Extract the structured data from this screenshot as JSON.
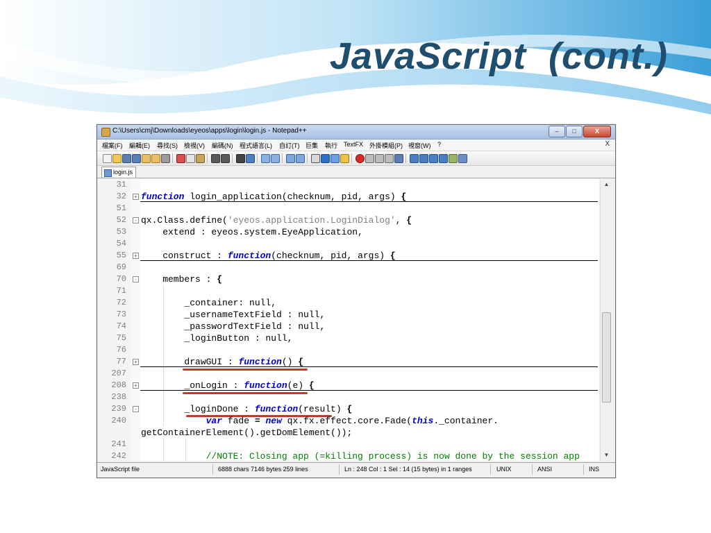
{
  "slide": {
    "title": "JavaScript  (cont.)"
  },
  "window": {
    "title": "C:\\Users\\cmj\\Downloads\\eyeos\\apps\\login\\login.js - Notepad++",
    "controls": {
      "minimize": "–",
      "maximize": "□",
      "close": "X"
    }
  },
  "menu": {
    "items": [
      "檔案(F)",
      "編輯(E)",
      "尋找(S)",
      "檢視(V)",
      "編碼(N)",
      "程式語言(L)",
      "自訂(T)",
      "巨集",
      "執行",
      "TextFX",
      "外掛模組(P)",
      "視窗(W)",
      "?"
    ],
    "close": "X"
  },
  "toolbar": {
    "icons": [
      "new-icon",
      "open-icon",
      "save-icon",
      "save-all-icon",
      "close-icon",
      "close-all-icon",
      "print-icon",
      "cut-icon",
      "copy-icon",
      "paste-icon",
      "undo-icon",
      "redo-icon",
      "find-icon",
      "replace-icon",
      "zoom-in-icon",
      "zoom-out-icon",
      "sync-v-icon",
      "sync-h-icon",
      "wrap-icon",
      "all-chars-icon",
      "indent-guide-icon",
      "udl-icon",
      "record-icon",
      "stop-icon",
      "play-icon",
      "play-multi-icon",
      "save-macro-icon",
      "compare-icon",
      "up-icon",
      "down-icon",
      "next-icon",
      "highlight-icon",
      "spell-icon"
    ]
  },
  "tab": {
    "label": "login.js"
  },
  "editor": {
    "lines": [
      {
        "num": "31",
        "text": "",
        "fold": ""
      },
      {
        "num": "32",
        "text": "function login_application(checknum, pid, args) {",
        "fold": "+"
      },
      {
        "num": "51",
        "text": "",
        "fold": ""
      },
      {
        "num": "52",
        "text": "qx.Class.define('eyeos.application.LoginDialog', {",
        "fold": "-"
      },
      {
        "num": "53",
        "text": "    extend : eyeos.system.EyeApplication,",
        "fold": ""
      },
      {
        "num": "54",
        "text": "",
        "fold": ""
      },
      {
        "num": "55",
        "text": "    construct : function(checknum, pid, args) {",
        "fold": "+"
      },
      {
        "num": "69",
        "text": "",
        "fold": ""
      },
      {
        "num": "70",
        "text": "    members : {",
        "fold": "-"
      },
      {
        "num": "71",
        "text": "",
        "fold": ""
      },
      {
        "num": "72",
        "text": "        _container: null,",
        "fold": ""
      },
      {
        "num": "73",
        "text": "        _usernameTextField : null,",
        "fold": ""
      },
      {
        "num": "74",
        "text": "        _passwordTextField : null,",
        "fold": ""
      },
      {
        "num": "75",
        "text": "        _loginButton : null,",
        "fold": ""
      },
      {
        "num": "76",
        "text": "",
        "fold": ""
      },
      {
        "num": "77",
        "text": "        drawGUI : function() {",
        "fold": "+"
      },
      {
        "num": "207",
        "text": "",
        "fold": ""
      },
      {
        "num": "208",
        "text": "        _onLogin : function(e) {",
        "fold": "+"
      },
      {
        "num": "238",
        "text": "",
        "fold": ""
      },
      {
        "num": "239",
        "text": "        _loginDone : function(result) {",
        "fold": "-"
      },
      {
        "num": "240",
        "text": "            var fade = new qx.fx.effect.core.Fade(this._container.",
        "fold": ""
      },
      {
        "num": "",
        "text": "getContainerElement().getDomElement());",
        "fold": ""
      },
      {
        "num": "241",
        "text": "",
        "fold": ""
      },
      {
        "num": "242",
        "text": "            //NOTE: Closing app (=killing process) is now done by the session app",
        "fold": ""
      }
    ]
  },
  "status": {
    "file_type": "JavaScript file",
    "chars": "6888 chars  7146 bytes  259 lines",
    "position": "Ln : 248   Col : 1   Sel : 14 (15 bytes) in 1 ranges",
    "eol": "UNIX",
    "encoding": "ANSI",
    "mode": "INS"
  },
  "colors": {
    "title": "#1f4e6e",
    "keyword": "#0000cc",
    "string": "#808080",
    "comment": "#008000",
    "annotation_underline": "#c0392b"
  }
}
